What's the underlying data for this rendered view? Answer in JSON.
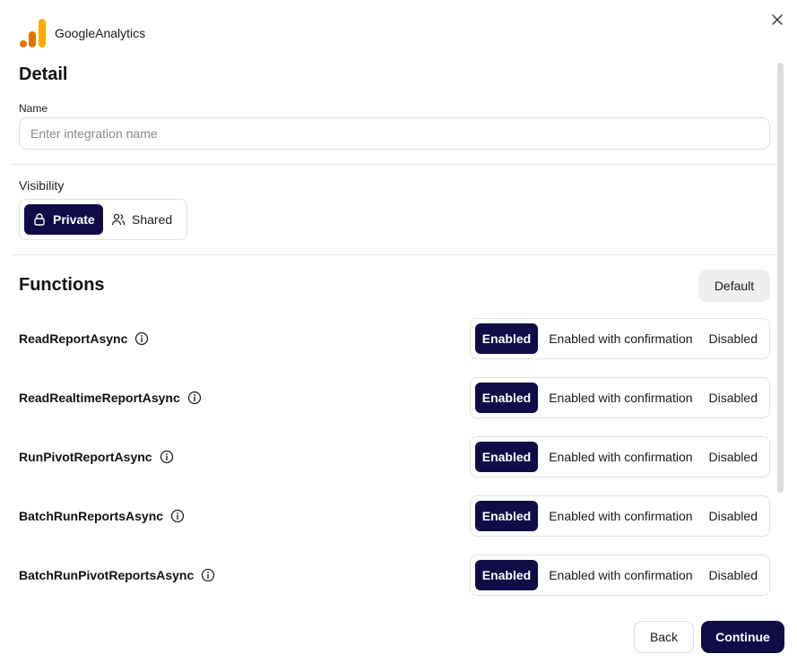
{
  "header": {
    "app_name": "GoogleAnalytics"
  },
  "detail": {
    "title": "Detail",
    "name_label": "Name",
    "name_value": "",
    "name_placeholder": "Enter integration name"
  },
  "visibility": {
    "label": "Visibility",
    "options": [
      {
        "label": "Private",
        "icon": "lock-icon",
        "selected": true
      },
      {
        "label": "Shared",
        "icon": "users-icon",
        "selected": false
      }
    ]
  },
  "functions": {
    "title": "Functions",
    "default_label": "Default",
    "state_labels": [
      "Enabled",
      "Enabled with confirmation",
      "Disabled"
    ],
    "items": [
      {
        "name": "ReadReportAsync",
        "state": "Enabled"
      },
      {
        "name": "ReadRealtimeReportAsync",
        "state": "Enabled"
      },
      {
        "name": "RunPivotReportAsync",
        "state": "Enabled"
      },
      {
        "name": "BatchRunReportsAsync",
        "state": "Enabled"
      },
      {
        "name": "BatchRunPivotReportsAsync",
        "state": "Enabled"
      }
    ]
  },
  "footer": {
    "back_label": "Back",
    "continue_label": "Continue"
  },
  "colors": {
    "accent": "#0f0c47",
    "logo_orange": "#f9ab00",
    "logo_dark_orange": "#e37400"
  }
}
